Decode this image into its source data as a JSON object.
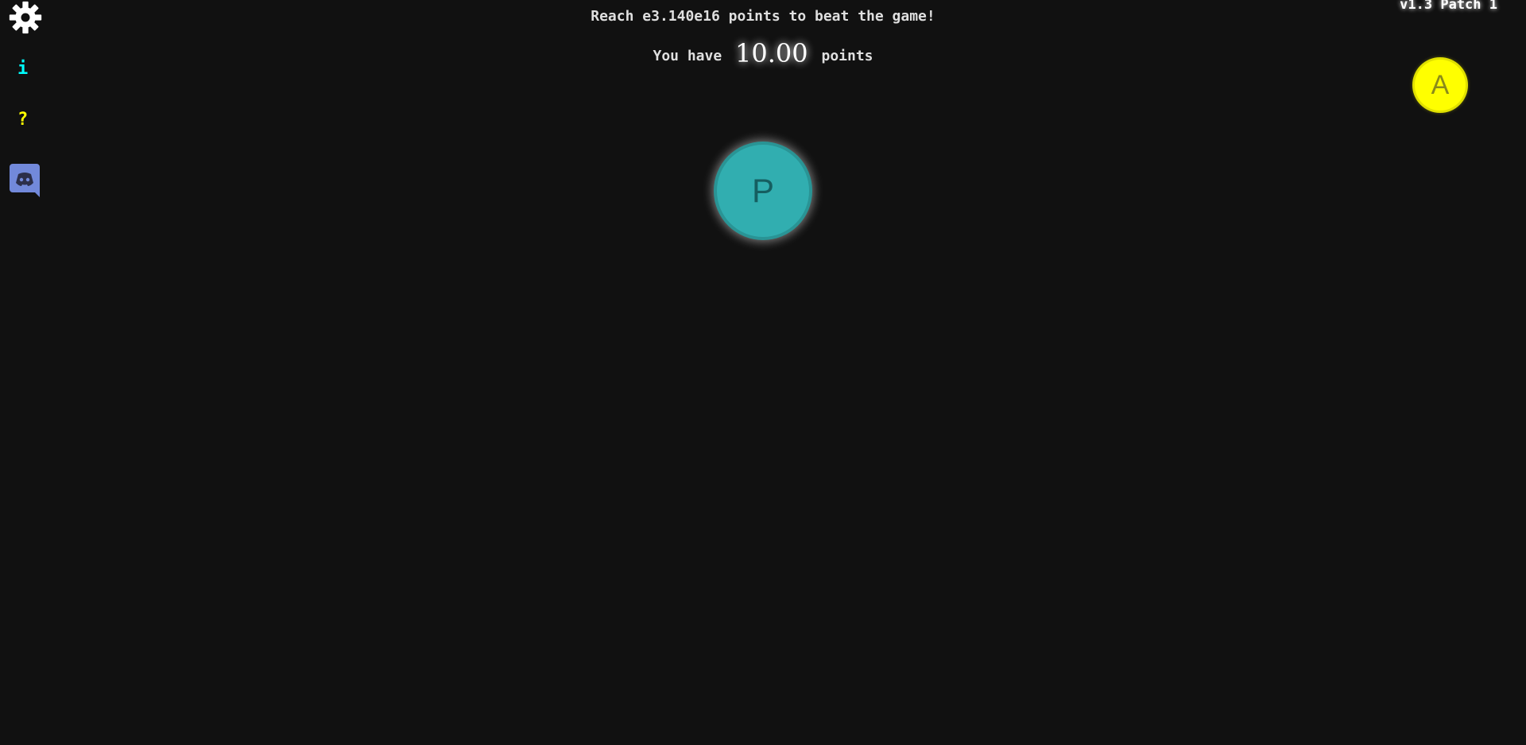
{
  "sidebar": {
    "settings_icon": "gear-icon",
    "info_label": "i",
    "help_label": "?",
    "discord_icon": "discord-icon"
  },
  "header": {
    "goal_text": "Reach e3.140e16 points to beat the game!",
    "points_prefix": "You have",
    "points_value": "10.00",
    "points_suffix": "points",
    "version": "v1.3 Patch 1"
  },
  "tree": {
    "nodes": [
      {
        "id": "A",
        "label": "A",
        "color": "#ffff00"
      },
      {
        "id": "P",
        "label": "P",
        "color": "#31aeb0"
      }
    ]
  },
  "colors": {
    "background": "#111111",
    "text": "#dfdfdf",
    "info": "#00ffff",
    "help": "#ffff00",
    "discord": "#7289da"
  }
}
